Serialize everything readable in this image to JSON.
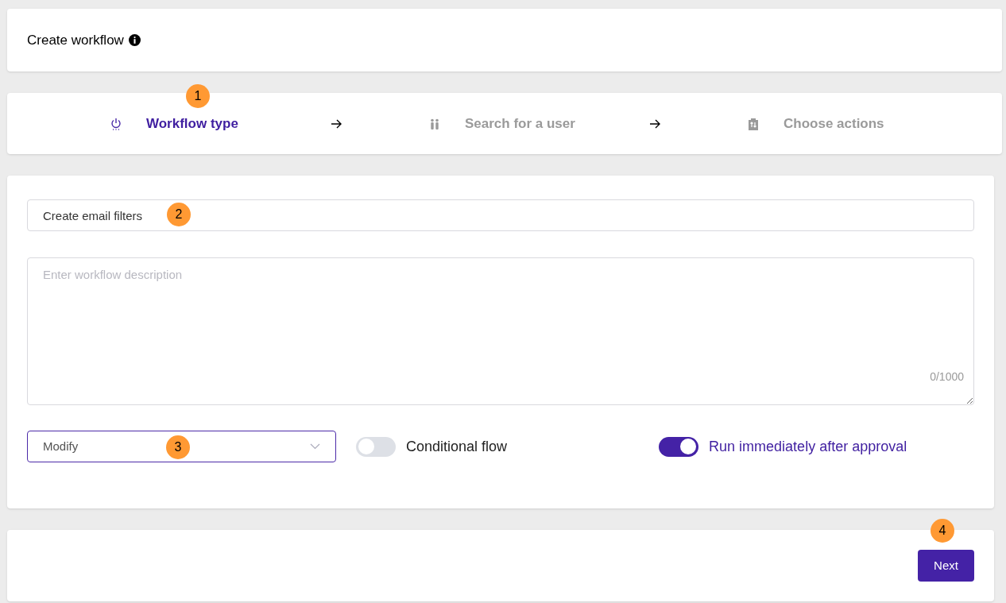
{
  "header": {
    "title": "Create workflow"
  },
  "steps": [
    {
      "label": "Workflow type",
      "selected": true,
      "kind": "power"
    },
    {
      "label": "Search for a user",
      "selected": false,
      "kind": "users"
    },
    {
      "label": "Choose actions",
      "selected": false,
      "kind": "clipboard"
    }
  ],
  "form": {
    "name": {
      "value": "Create email filters"
    },
    "description": {
      "placeholder": "Enter workflow description",
      "counter": "0/1000"
    },
    "type_select": {
      "value": "Modify"
    },
    "toggles": [
      {
        "label": "Conditional flow",
        "on": false
      },
      {
        "label": "Run immediately after approval",
        "on": true
      }
    ]
  },
  "footer": {
    "button": "Next"
  },
  "markers": [
    "1",
    "2",
    "3",
    "4"
  ]
}
